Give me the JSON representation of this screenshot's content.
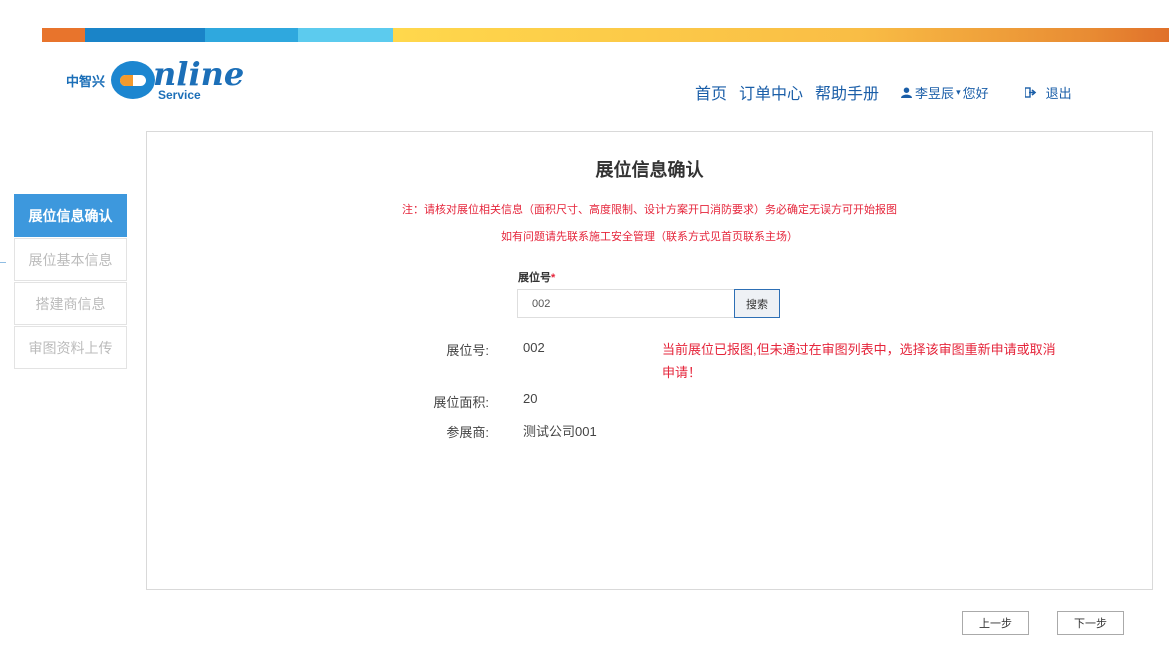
{
  "brand": {
    "cn": "中智兴",
    "script": "nline",
    "sub": "Service"
  },
  "nav": {
    "items": [
      {
        "label": "首页"
      },
      {
        "label": "订单中心"
      },
      {
        "label": "帮助手册"
      }
    ],
    "user": "李昱辰",
    "greeting": "您好",
    "logout": "退出"
  },
  "sidebar": {
    "items": [
      {
        "label": "展位信息确认",
        "active": true
      },
      {
        "label": "展位基本信息",
        "active": false
      },
      {
        "label": "搭建商信息",
        "active": false
      },
      {
        "label": "审图资料上传",
        "active": false
      }
    ]
  },
  "main": {
    "title": "展位信息确认",
    "note1": "注：请核对展位相关信息（面积尺寸、高度限制、设计方案开口消防要求）务必确定无误方可开始报图",
    "note2": "如有问题请先联系施工安全管理（联系方式见首页联系主场）",
    "search": {
      "label": "展位号",
      "required_mark": "*",
      "value": "002",
      "button": "搜索"
    },
    "info": {
      "booth_label": "展位号:",
      "booth_value": "002",
      "area_label": "展位面积:",
      "area_value": "20",
      "exhibitor_label": "参展商:",
      "exhibitor_value": "测试公司001"
    },
    "warning": "当前展位已报图,但未通过在审图列表中，选择该审图重新申请或取消申请！"
  },
  "footer": {
    "prev": "上一步",
    "next": "下一步"
  },
  "colors": {
    "accent": "#3d98dd",
    "brand_blue": "#1a5ea8",
    "warning": "#e5253b"
  }
}
